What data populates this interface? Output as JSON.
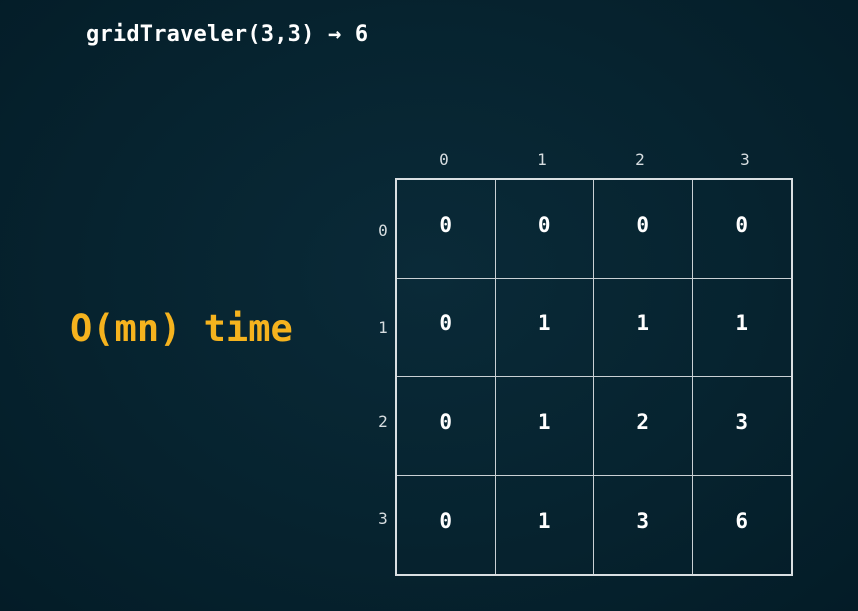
{
  "title": "gridTraveler(3,3) → 6",
  "complexity": "O(mn) time",
  "col_labels": [
    "0",
    "1",
    "2",
    "3"
  ],
  "row_labels": [
    "0",
    "1",
    "2",
    "3"
  ],
  "table": [
    [
      "0",
      "0",
      "0",
      "0"
    ],
    [
      "0",
      "1",
      "1",
      "1"
    ],
    [
      "0",
      "1",
      "2",
      "3"
    ],
    [
      "0",
      "1",
      "3",
      "6"
    ]
  ],
  "colors": {
    "background": "#06232f",
    "accent": "#f5b31e",
    "text": "#ffffff",
    "grid_line": "#d9dfe2"
  }
}
